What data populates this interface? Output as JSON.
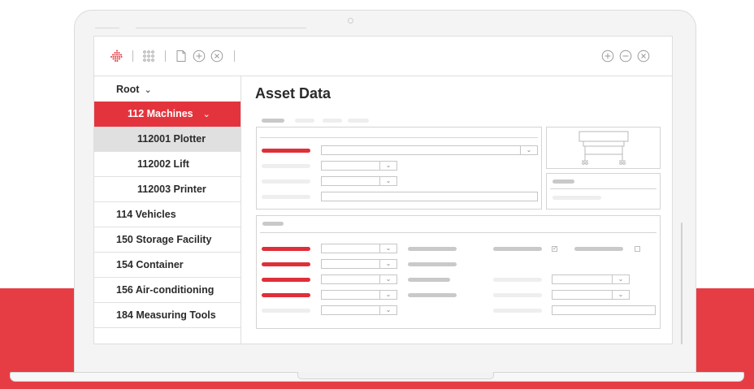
{
  "app": {
    "page_title": "Asset Data"
  },
  "tree": {
    "root_label": "Root",
    "items": [
      {
        "label": "112 Machines",
        "level": 1,
        "state": "expanded-active"
      },
      {
        "label": "112001 Plotter",
        "level": 2,
        "state": "selected"
      },
      {
        "label": "112002 Lift",
        "level": 2,
        "state": "normal"
      },
      {
        "label": "112003 Printer",
        "level": 2,
        "state": "normal"
      },
      {
        "label": "114 Vehicles",
        "level": 1,
        "state": "normal"
      },
      {
        "label": "150 Storage Facility",
        "level": 1,
        "state": "normal"
      },
      {
        "label": "154 Container",
        "level": 1,
        "state": "normal"
      },
      {
        "label": "156 Air-conditioning",
        "level": 1,
        "state": "normal"
      },
      {
        "label": "184 Measuring Tools",
        "level": 1,
        "state": "normal"
      }
    ]
  },
  "icons": {
    "logo": "diamond-logo-icon",
    "grid": "grid-icon",
    "document": "document-icon",
    "add": "plus-circle-icon",
    "close": "x-circle-icon",
    "window_add": "plus-circle-icon",
    "window_minimize": "minus-circle-icon",
    "window_close": "x-circle-icon",
    "chevron": "chevron-down-icon",
    "preview": "plotter-image-icon"
  },
  "colors": {
    "accent": "#e3343e",
    "band": "#e63d45",
    "selected_row": "#e0e0e0",
    "placeholder_bar": "#c9c9c9"
  }
}
